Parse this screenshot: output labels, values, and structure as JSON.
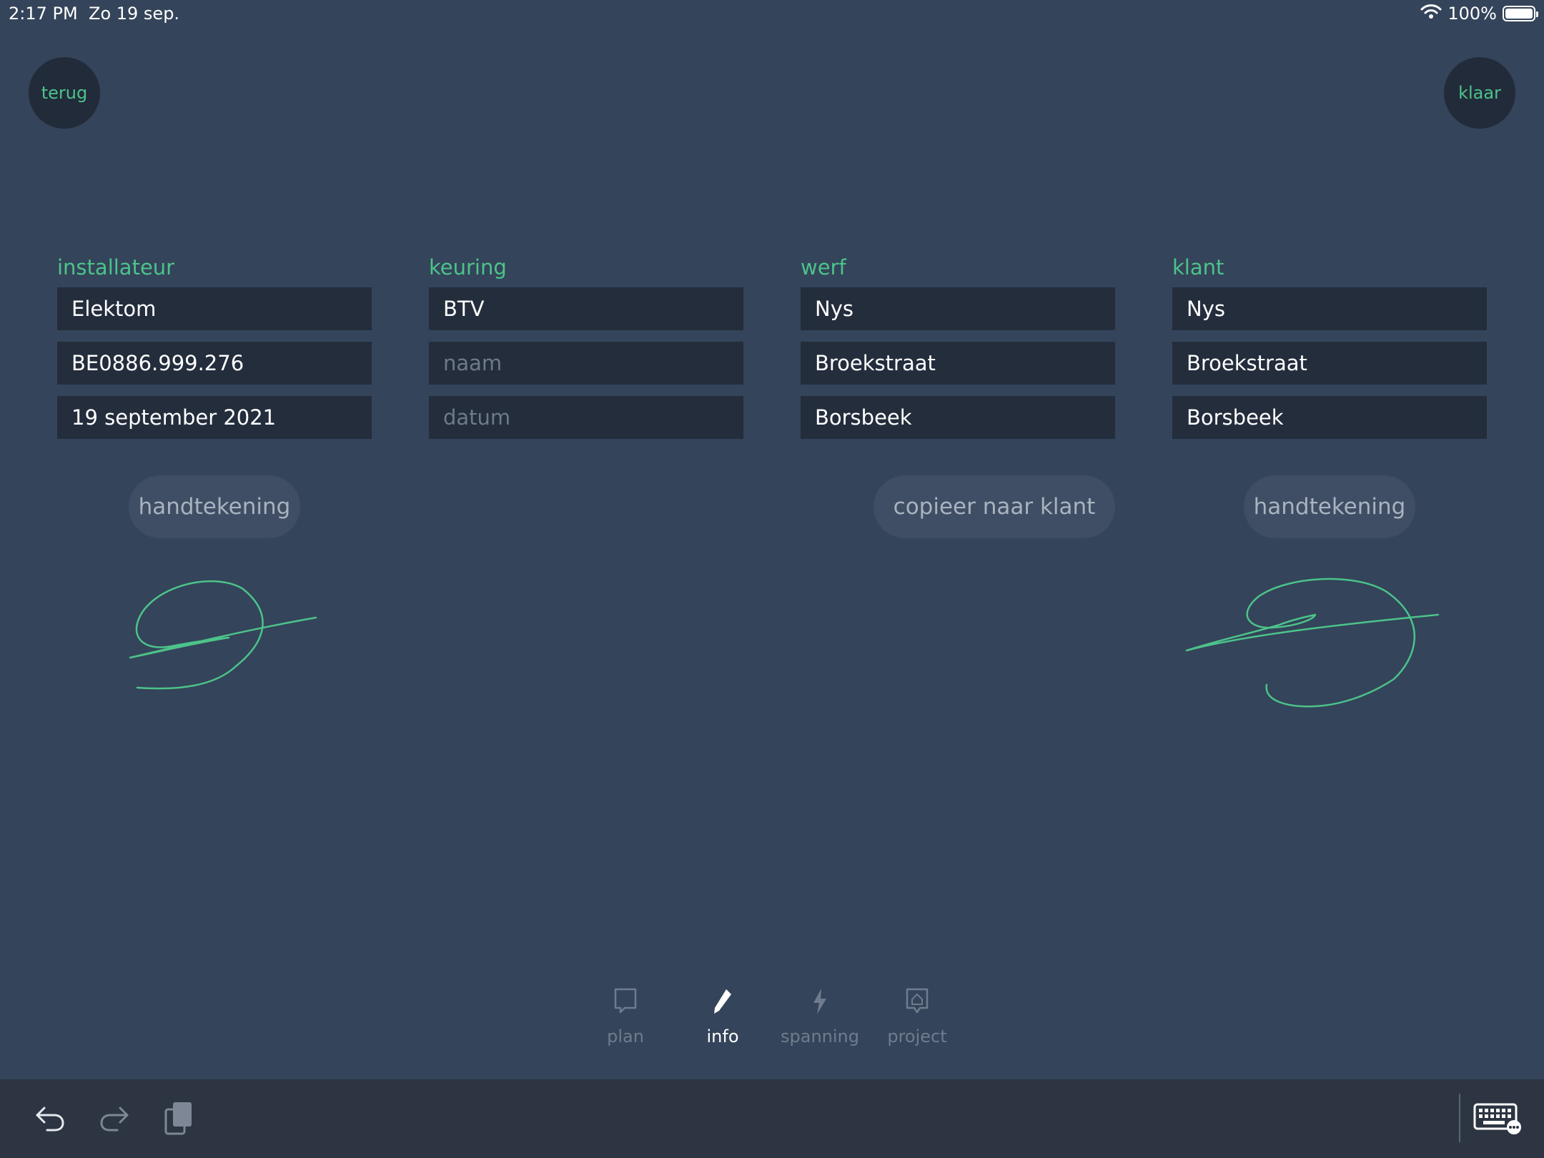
{
  "status_bar": {
    "time": "2:17 PM",
    "date": "Zo 19 sep.",
    "battery": "100%",
    "battery_level": 1.0
  },
  "nav": {
    "back_label": "terug",
    "done_label": "klaar"
  },
  "columns": [
    {
      "title": "installateur",
      "fields": [
        {
          "value": "Elektom",
          "placeholder": ""
        },
        {
          "value": "BE0886.999.276",
          "placeholder": ""
        },
        {
          "value": "19 september 2021",
          "placeholder": ""
        }
      ]
    },
    {
      "title": "keuring",
      "fields": [
        {
          "value": "BTV",
          "placeholder": ""
        },
        {
          "value": "",
          "placeholder": "naam"
        },
        {
          "value": "",
          "placeholder": "datum"
        }
      ]
    },
    {
      "title": "werf",
      "fields": [
        {
          "value": "Nys",
          "placeholder": ""
        },
        {
          "value": "Broekstraat",
          "placeholder": ""
        },
        {
          "value": "Borsbeek",
          "placeholder": ""
        }
      ]
    },
    {
      "title": "klant",
      "fields": [
        {
          "value": "Nys",
          "placeholder": ""
        },
        {
          "value": "Broekstraat",
          "placeholder": ""
        },
        {
          "value": "Borsbeek",
          "placeholder": ""
        }
      ]
    }
  ],
  "actions": {
    "installer_signature": "handtekening",
    "copy_to_client": "copieer naar klant",
    "client_signature": "handtekening"
  },
  "tabs": [
    {
      "label": "plan",
      "icon": "chat-bubble-icon",
      "active": false
    },
    {
      "label": "info",
      "icon": "pencil-icon",
      "active": true
    },
    {
      "label": "spanning",
      "icon": "lightning-icon",
      "active": false
    },
    {
      "label": "project",
      "icon": "house-icon",
      "active": false
    }
  ],
  "colors": {
    "background": "#34445a",
    "accent": "#4cc38a",
    "field": "#232d3c",
    "pill": "#3f4e64"
  }
}
